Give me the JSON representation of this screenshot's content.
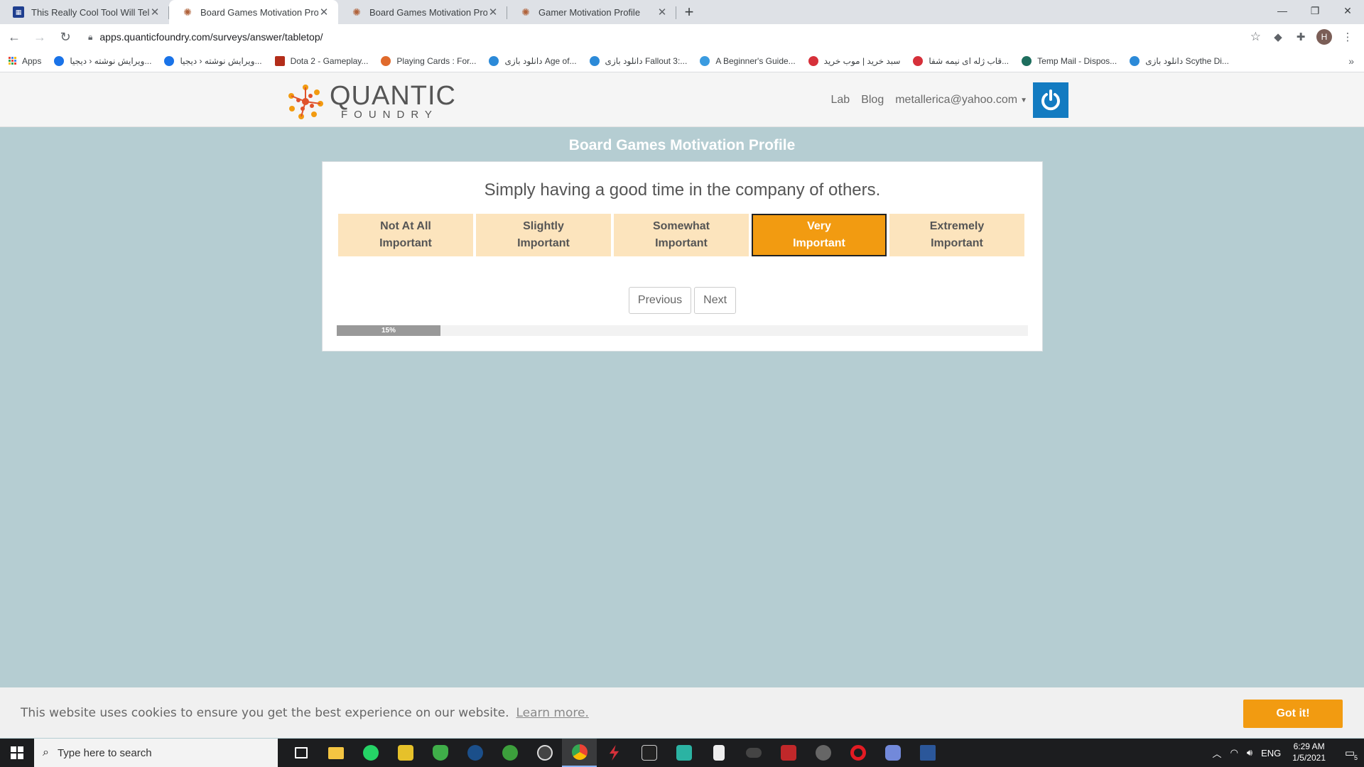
{
  "browser": {
    "tabs": [
      {
        "title": "This Really Cool Tool Will Tell You",
        "active": false,
        "icon": "sheet-icon"
      },
      {
        "title": "Board Games Motivation Profile",
        "active": true,
        "icon": "quantic-favicon"
      },
      {
        "title": "Board Games Motivation Profile",
        "active": false,
        "icon": "quantic-favicon"
      },
      {
        "title": "Gamer Motivation Profile",
        "active": false,
        "icon": "quantic-favicon"
      }
    ],
    "url": "apps.quanticfoundry.com/surveys/answer/tabletop/",
    "profile_initial": "H",
    "bookmarks": [
      {
        "label": "Apps",
        "color": "#4285f4"
      },
      {
        "label": "ویرایش نوشته ‹ دیجیا...",
        "color": "#1a73e8"
      },
      {
        "label": "ویرایش نوشته ‹ دیجیا...",
        "color": "#1a73e8"
      },
      {
        "label": "Dota 2 - Gameplay...",
        "color": "#b32d1a"
      },
      {
        "label": "Playing Cards : For...",
        "color": "#e06a2c"
      },
      {
        "label": "دانلود بازی Age of...",
        "color": "#2c8ad8"
      },
      {
        "label": "دانلود بازی Fallout 3:...",
        "color": "#2c8ad8"
      },
      {
        "label": "A Beginner's Guide...",
        "color": "#3a9be0"
      },
      {
        "label": "سبد خرید | موب خرید",
        "color": "#d6303a"
      },
      {
        "label": "قاب ژله ای نیمه شفا...",
        "color": "#d6303a"
      },
      {
        "label": "Temp Mail - Dispos...",
        "color": "#1e6e5e"
      },
      {
        "label": "دانلود بازی Scythe Di...",
        "color": "#2c8ad8"
      }
    ]
  },
  "site": {
    "logo_word1": "QUANTIC",
    "logo_word2": "FOUNDRY",
    "nav": {
      "lab": "Lab",
      "blog": "Blog",
      "account": "metallerica@yahoo.com"
    }
  },
  "survey": {
    "title": "Board Games Motivation Profile",
    "question": "Simply having a good time in the company of others.",
    "options": [
      {
        "line1": "Not At All",
        "line2": "Important",
        "selected": false
      },
      {
        "line1": "Slightly",
        "line2": "Important",
        "selected": false
      },
      {
        "line1": "Somewhat",
        "line2": "Important",
        "selected": false
      },
      {
        "line1": "Very",
        "line2": "Important",
        "selected": true
      },
      {
        "line1": "Extremely",
        "line2": "Important",
        "selected": false
      }
    ],
    "previous_label": "Previous",
    "next_label": "Next",
    "progress_label": "15%",
    "progress_fraction": 0.15,
    "accent_color": "#f29b11",
    "option_bg_color": "#fce4bd"
  },
  "cookie_bar": {
    "message": "This website uses cookies to ensure you get the best experience on our website.",
    "learn_more": "Learn more.",
    "accept_label": "Got it!"
  },
  "taskbar": {
    "search_placeholder": "Type here to search",
    "language": "ENG",
    "time": "6:29 AM",
    "date": "1/5/2021",
    "notification_count": "5"
  }
}
